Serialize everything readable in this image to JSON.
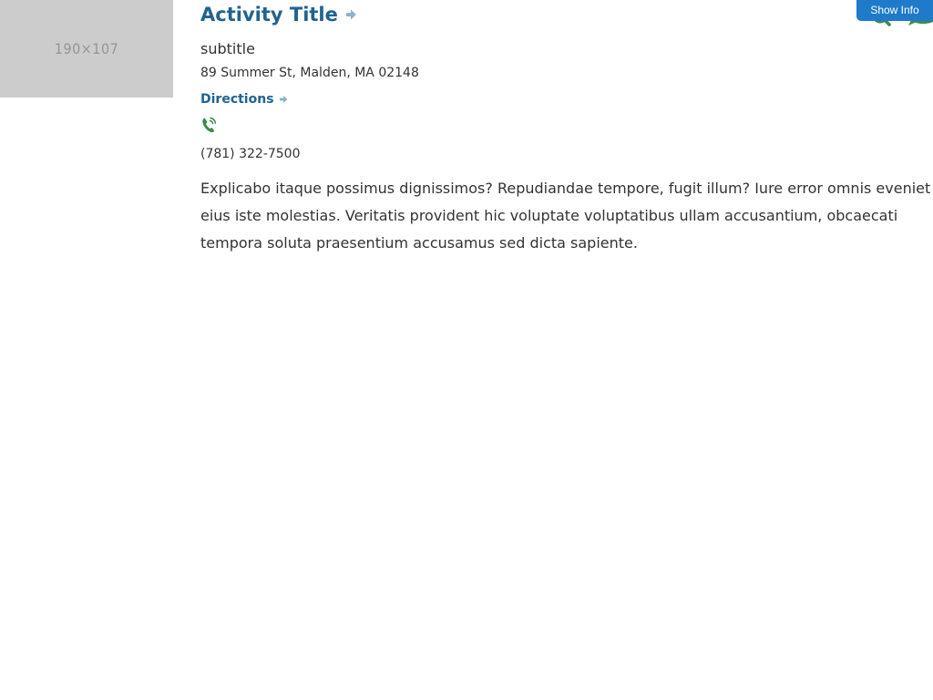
{
  "thumbnail": {
    "label": "190×107"
  },
  "activity": {
    "title": "Activity Title",
    "subtitle": "subtitle",
    "address": "89 Summer St, Malden, MA 02148",
    "directions_label": "Directions",
    "phone": "(781) 322-7500",
    "description": "Explicabo itaque possimus dignissimos? Repudiandae tempore, fugit illum? Iure error omnis eveniet eius iste molestias. Veritatis provident hic voluptate voluptatibus ullam accusantium, obcaecati tempora soluta praesentium accusamus sed dicta sapiente."
  },
  "toggle": {
    "show_info_label": "Show Info"
  },
  "icons": {
    "title_arrow": "arrow-right-icon",
    "directions_arrow": "arrow-right-icon",
    "phone": "phone-icon",
    "corner": [
      "zoom-icon",
      "chat-icon"
    ]
  },
  "colors": {
    "link": "#1f6391",
    "arrow": "#8fb2cc",
    "icon_green": "#3a8a4a",
    "button": "#1f7bc9",
    "placeholder": "#cccccc",
    "text": "#333333"
  }
}
